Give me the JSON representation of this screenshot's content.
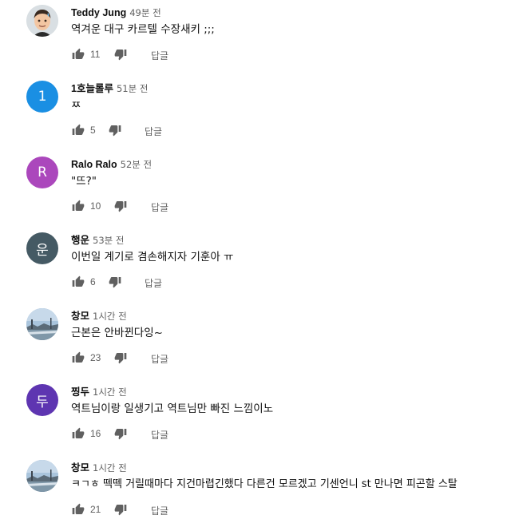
{
  "comments": [
    {
      "author": "Teddy Jung",
      "time": "49분 전",
      "text": "역겨운 대구 카르텔 수장새키 ;;;",
      "likes": "11",
      "reply_label": "답글",
      "avatar": {
        "type": "memoji-icon",
        "bg": "#cfd8dc"
      }
    },
    {
      "author": "1호늘롤루",
      "time": "51분 전",
      "text": "ㅉ",
      "likes": "5",
      "reply_label": "답글",
      "avatar": {
        "type": "letter",
        "letter": "1",
        "bg": "#1a8fe3"
      }
    },
    {
      "author": "Ralo Ralo",
      "time": "52분 전",
      "text": "\"뜨?\"",
      "likes": "10",
      "reply_label": "답글",
      "avatar": {
        "type": "letter",
        "letter": "R",
        "bg": "#ab47bc"
      }
    },
    {
      "author": "행운",
      "time": "53분 전",
      "text": "이번일 계기로 겸손해지자 기훈아 ㅠ",
      "likes": "6",
      "reply_label": "답글",
      "avatar": {
        "type": "letter",
        "letter": "운",
        "bg": "#455a64"
      }
    },
    {
      "author": "창모",
      "time": "1시간 전",
      "text": "근본은 안바뀐다잉~",
      "likes": "23",
      "reply_label": "답글",
      "avatar": {
        "type": "landscape-photo",
        "bg": "#8fb1cc"
      }
    },
    {
      "author": "찡두",
      "time": "1시간 전",
      "text": "역트님이랑 일생기고 역트님만 빠진 느낌이노",
      "likes": "16",
      "reply_label": "답글",
      "avatar": {
        "type": "letter",
        "letter": "두",
        "bg": "#5e35b1"
      }
    },
    {
      "author": "창모",
      "time": "1시간 전",
      "text": "ㅋㄱㅎ 떽떽 거릴때마다 지건마렵긴했다 다른건 모르겠고 기센언니 st 만나면 피곤할 스탈",
      "likes": "21",
      "reply_label": "답글",
      "avatar": {
        "type": "landscape-photo",
        "bg": "#8fb1cc"
      }
    }
  ],
  "colors": {
    "text": "#0f0f0f",
    "secondary": "#606060",
    "icon": "#606060"
  }
}
